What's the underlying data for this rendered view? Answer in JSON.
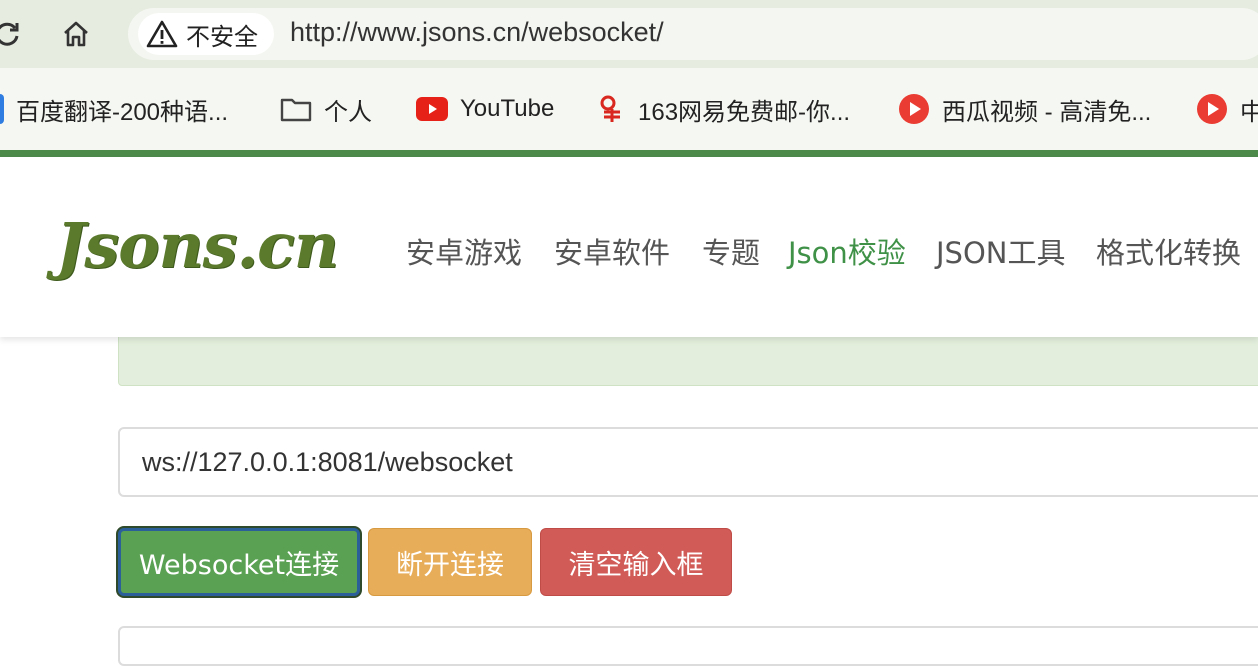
{
  "browser": {
    "security_label": "不安全",
    "url": "http://www.jsons.cn/websocket/",
    "icons": {
      "reload": "reload-icon",
      "home": "home-icon",
      "warning": "warning-icon"
    }
  },
  "bookmarks": [
    {
      "label": "百度翻译-200种语...",
      "icon": "baidu-translate-icon"
    },
    {
      "label": "个人",
      "icon": "folder-icon"
    },
    {
      "label": "YouTube",
      "icon": "youtube-icon"
    },
    {
      "label": "163网易免费邮-你...",
      "icon": "netease-icon"
    },
    {
      "label": "西瓜视频 - 高清免...",
      "icon": "xigua-icon"
    },
    {
      "label": "中",
      "icon": "xigua-icon"
    }
  ],
  "site": {
    "logo": "Jsons.cn",
    "nav": [
      {
        "label": "安卓游戏",
        "active": false
      },
      {
        "label": "安卓软件",
        "active": false
      },
      {
        "label": "专题",
        "active": false
      },
      {
        "label": "Json校验",
        "active": true
      },
      {
        "label": "JSON工具",
        "active": false
      },
      {
        "label": "格式化转换",
        "active": false
      }
    ]
  },
  "websocket": {
    "url_value": "ws://127.0.0.1:8081/websocket",
    "connect_label": "Websocket连接",
    "disconnect_label": "断开连接",
    "clear_label": "清空输入框"
  },
  "colors": {
    "brand_green": "#4c8a4a",
    "nav_active": "#3f9147",
    "connect": "#5aa154",
    "disconnect": "#e8ad58",
    "clear": "#d15b57"
  }
}
